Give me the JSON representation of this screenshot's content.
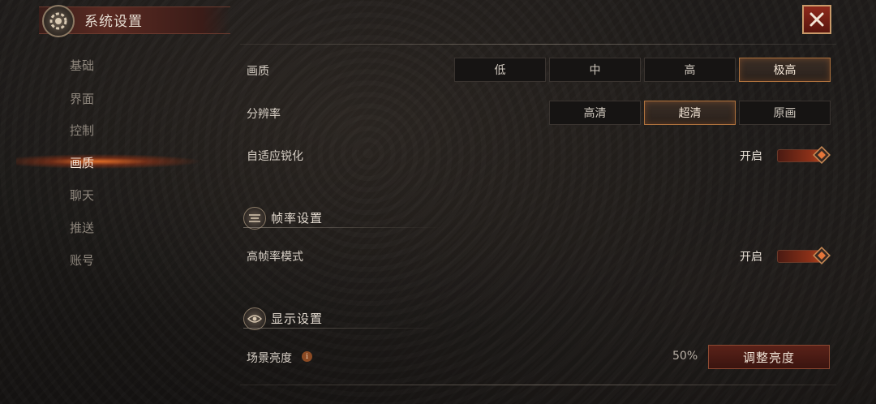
{
  "header": {
    "title": "系统设置",
    "emblem_icon": "gear-icon",
    "close_icon": "close-icon"
  },
  "sidebar": {
    "items": [
      {
        "label": "基础",
        "active": false
      },
      {
        "label": "界面",
        "active": false
      },
      {
        "label": "控制",
        "active": false
      },
      {
        "label": "画质",
        "active": true
      },
      {
        "label": "聊天",
        "active": false
      },
      {
        "label": "推送",
        "active": false
      },
      {
        "label": "账号",
        "active": false
      }
    ]
  },
  "quality": {
    "label": "画质",
    "options": [
      "低",
      "中",
      "高",
      "极高"
    ],
    "selected": "极高"
  },
  "resolution": {
    "label": "分辨率",
    "options": [
      "高清",
      "超清",
      "原画"
    ],
    "selected": "超清"
  },
  "sharpen": {
    "label": "自适应锐化",
    "state": "开启",
    "on": true
  },
  "framerate_section": {
    "title": "帧率设置",
    "icon": "framerate-icon",
    "high_fps": {
      "label": "高帧率模式",
      "state": "开启",
      "on": true
    }
  },
  "display_section": {
    "title": "显示设置",
    "icon": "eye-icon",
    "brightness": {
      "label": "场景亮度",
      "info_icon": "info-icon",
      "value": "50%",
      "button_label": "调整亮度"
    }
  },
  "colors": {
    "accent": "#b0733e",
    "active_glow": "#ff7828",
    "close_button": "#8e2a1c"
  }
}
